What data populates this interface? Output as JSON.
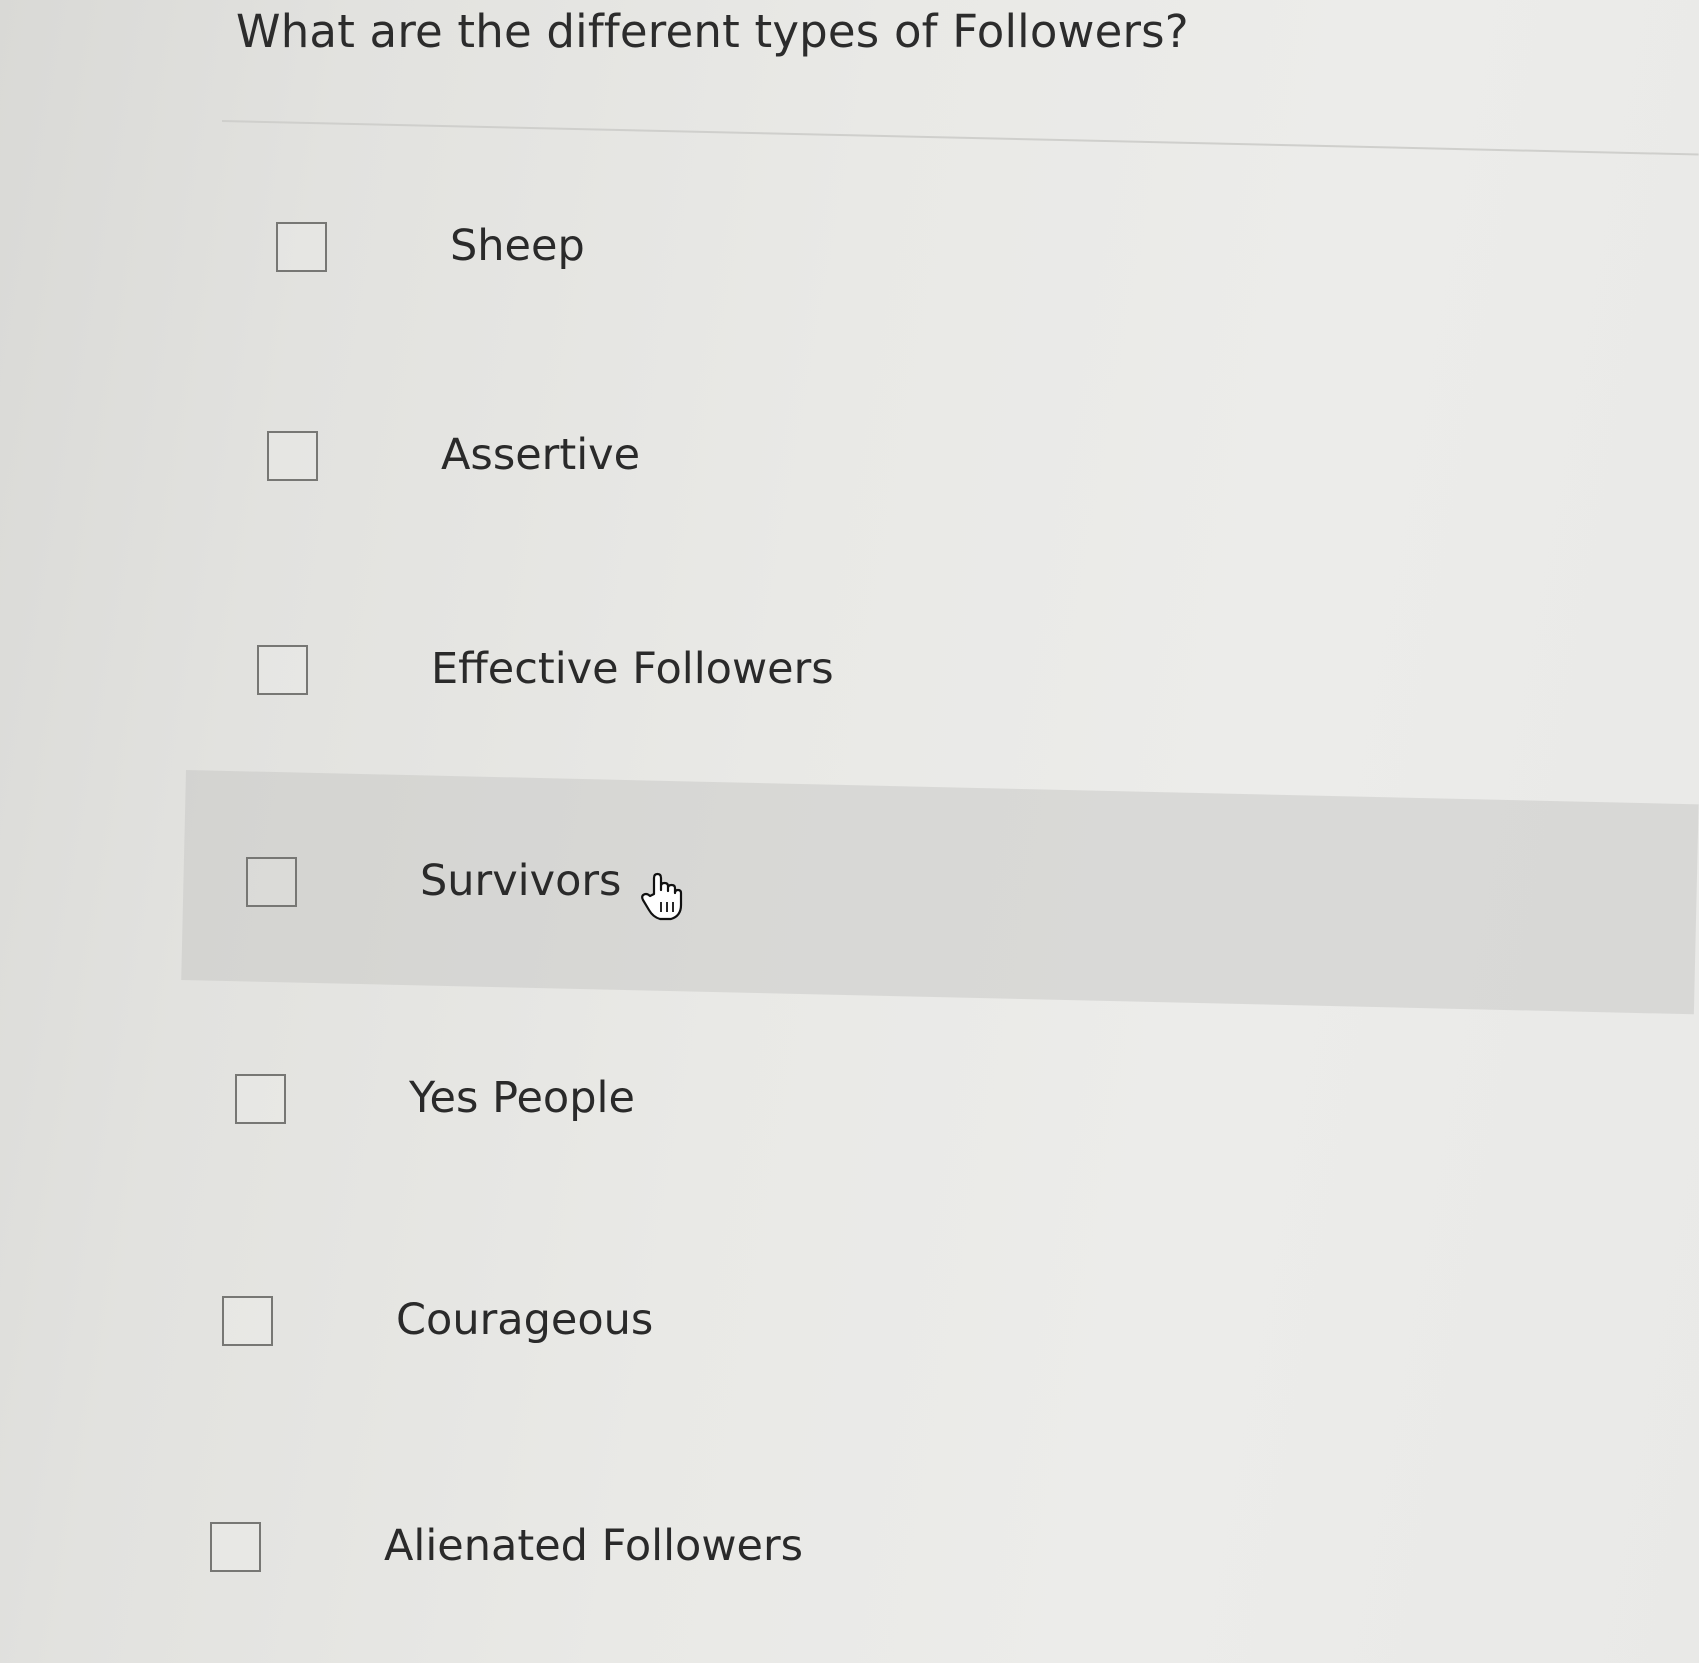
{
  "question": {
    "text": "What are the different types of Followers?"
  },
  "options": [
    {
      "label": "Sheep",
      "checked": false
    },
    {
      "label": "Assertive",
      "checked": false
    },
    {
      "label": "Effective Followers",
      "checked": false
    },
    {
      "label": "Survivors",
      "checked": false,
      "hovered": true
    },
    {
      "label": "Yes People",
      "checked": false
    },
    {
      "label": "Courageous",
      "checked": false
    },
    {
      "label": "Alienated Followers",
      "checked": false
    }
  ],
  "cursor": {
    "icon": "hand-pointer-icon"
  }
}
